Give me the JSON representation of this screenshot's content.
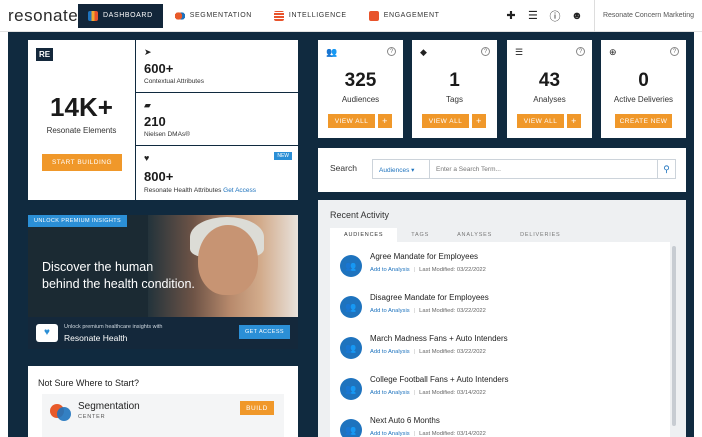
{
  "nav": {
    "logo": "resonate",
    "tabs": [
      {
        "label": "DASHBOARD"
      },
      {
        "label": "SEGMENTATION"
      },
      {
        "label": "INTELLIGENCE"
      },
      {
        "label": "ENGAGEMENT"
      }
    ],
    "account": "Resonate Concern Marketing",
    "icons": [
      "plus-icon",
      "list-icon",
      "help-icon",
      "user-icon"
    ]
  },
  "elements": {
    "badge": "RE",
    "value": "14K+",
    "label": "Resonate Elements",
    "button": "START BUILDING",
    "attributes": [
      {
        "value": "600+",
        "label": "Contextual Attributes"
      },
      {
        "value": "210",
        "label": "Nielsen DMAs®"
      },
      {
        "value": "800+",
        "label": "Resonate Health Attributes",
        "link": "Get Access",
        "badge": "NEW"
      }
    ]
  },
  "stats": [
    {
      "value": "325",
      "label": "Audiences",
      "button": "VIEW ALL",
      "plus": "+"
    },
    {
      "value": "1",
      "label": "Tags",
      "button": "VIEW ALL",
      "plus": "+"
    },
    {
      "value": "43",
      "label": "Analyses",
      "button": "VIEW ALL",
      "plus": "+"
    },
    {
      "value": "0",
      "label": "Active Deliveries",
      "button": "CREATE NEW"
    }
  ],
  "promo": {
    "tag": "UNLOCK PREMIUM INSIGHTS",
    "headline_1": "Discover the human",
    "headline_2": "behind the health condition.",
    "footer_text": "Unlock premium healthcare insights with",
    "footer_brand": "Resonate Health",
    "button": "GET ACCESS"
  },
  "search": {
    "label": "Search",
    "select": "Audiences ▾",
    "placeholder": "Enter a Search Term..."
  },
  "recent": {
    "title": "Recent Activity",
    "tabs": [
      "AUDIENCES",
      "TAGS",
      "ANALYSES",
      "DELIVERIES"
    ],
    "items": [
      {
        "name": "Agree Mandate for Employees",
        "link": "Add to Analysis",
        "modified": "Last Modified: 03/22/2022"
      },
      {
        "name": "Disagree Mandate for Employees",
        "link": "Add to Analysis",
        "modified": "Last Modified: 03/22/2022"
      },
      {
        "name": "March Madness Fans + Auto Intenders",
        "link": "Add to Analysis",
        "modified": "Last Modified: 03/22/2022"
      },
      {
        "name": "College Football Fans + Auto Intenders",
        "link": "Add to Analysis",
        "modified": "Last Modified: 03/14/2022"
      },
      {
        "name": "Next Auto 6 Months",
        "link": "Add to Analysis",
        "modified": "Last Modified: 03/14/2022"
      }
    ]
  },
  "notsure": {
    "title": "Not Sure Where to Start?",
    "name": "Segmentation",
    "sub": "CENTER",
    "button": "BUILD"
  },
  "colors": {
    "navy": "#102a3f",
    "orange": "#f0982a",
    "blue": "#1e73be"
  }
}
